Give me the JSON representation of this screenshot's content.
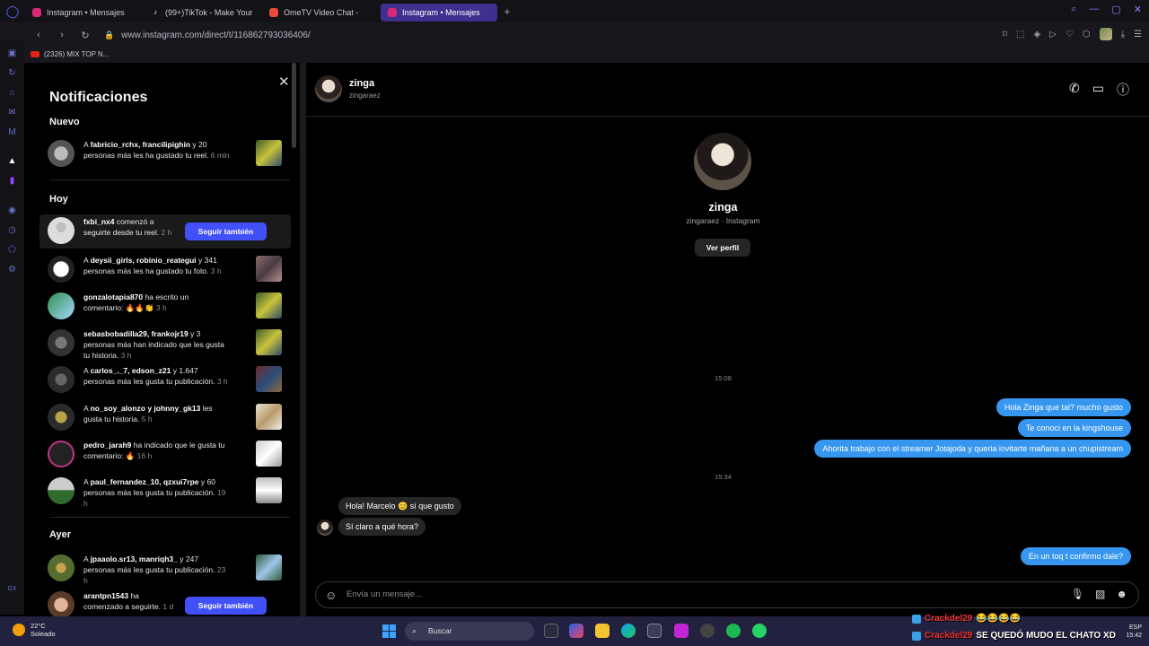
{
  "browser": {
    "tabs": [
      {
        "label": "Instagram • Mensajes",
        "color": "#d62976"
      },
      {
        "label": "(99+)TikTok - Make Your",
        "color": "#111111"
      },
      {
        "label": "OmeTV Video Chat -",
        "color": "#e74c3c"
      },
      {
        "label": "Instagram • Mensajes",
        "color": "#d62976",
        "active": true
      }
    ],
    "new_tab": "+",
    "url": "www.instagram.com/direct/t/116862793036406/",
    "bookmark": "(2326) MIX TOP N..."
  },
  "notifications": {
    "title": "Notificaciones",
    "sections": {
      "nuevo": "Nuevo",
      "hoy": "Hoy",
      "ayer": "Ayer"
    },
    "follow_back_label": "Seguir también",
    "items": [
      {
        "pre": "A ",
        "users": "fabricio_rchx, francilipighin",
        "text": " y 20 personas más les ha gustado tu reel.",
        "time": " 6 min"
      },
      {
        "pre": "",
        "users": "fxbi_nx4",
        "text": " comenzó a seguirte desde tu reel.",
        "time": " 2 h"
      },
      {
        "pre": "A ",
        "users": "deysii_girls, robinio_reategui",
        "text": " y 341 personas más les ha gustado tu foto.",
        "time": " 3 h"
      },
      {
        "pre": "",
        "users": "gonzalotapia870",
        "text": " ha escrito un comentario: 🔥🔥👏",
        "time": " 3 h"
      },
      {
        "pre": "",
        "users": "sebasbobadilla29, frankojr19",
        "text": " y 3 personas más han indicado que les gusta tu historia.",
        "time": " 3 h"
      },
      {
        "pre": "A ",
        "users": "carlos_._7, edson_z21",
        "text": " y 1.647 personas más les gusta tu publicación.",
        "time": " 3 h"
      },
      {
        "pre": "A ",
        "users": "no_soy_alonzo y johnny_gk13",
        "text": " les gusta tu historia.",
        "time": " 5 h"
      },
      {
        "pre": "",
        "users": "pedro_jarah9",
        "text": " ha indicado que le gusta tu comentario: 🔥",
        "time": " 16 h"
      },
      {
        "pre": "A ",
        "users": "paul_fernandez_10, qzxui7rpe",
        "text": " y 60 personas más les gusta tu publicación.",
        "time": " 19 h"
      },
      {
        "pre": "A ",
        "users": "jpaaolo.sr13, manriqh3_",
        "text": " y 247 personas más les gusta tu publicación.",
        "time": " 23 h"
      },
      {
        "pre": "",
        "users": "arantpn1543",
        "text": " ha comenzado a seguirte.",
        "time": " 1 d"
      }
    ]
  },
  "chat": {
    "header": {
      "name": "zinga",
      "username": "zingaraez"
    },
    "profile": {
      "name": "zinga",
      "subtitle": "zingaraez · Instagram",
      "button": "Ver perfil"
    },
    "timestamps": [
      "15:08",
      "15:34"
    ],
    "outgoing": [
      "Hola Zinga que tal? mucho gusto",
      "Te conoci en la kingshouse",
      "Ahorita trabajo con el streamer Jotajoda y queria invitarte mañana a un chupistream",
      "En un toq t confirmo dale?"
    ],
    "incoming": [
      "Hola! Marcelo 😊 sí que gusto",
      "Sí claro a qué hora?"
    ],
    "composer_placeholder": "Envía un mensaje..."
  },
  "taskbar": {
    "weather_temp": "22°C",
    "weather_desc": "Soleado",
    "search": "Buscar",
    "tray_lang": "ESP",
    "tray_time": "15:42"
  },
  "overlay": {
    "user1": "Crackdel29",
    "emojis1": "😂😂😂😂",
    "user2": "Crackdel29",
    "msg2": "SE QUEDÓ MUDO EL CHATO XD"
  }
}
